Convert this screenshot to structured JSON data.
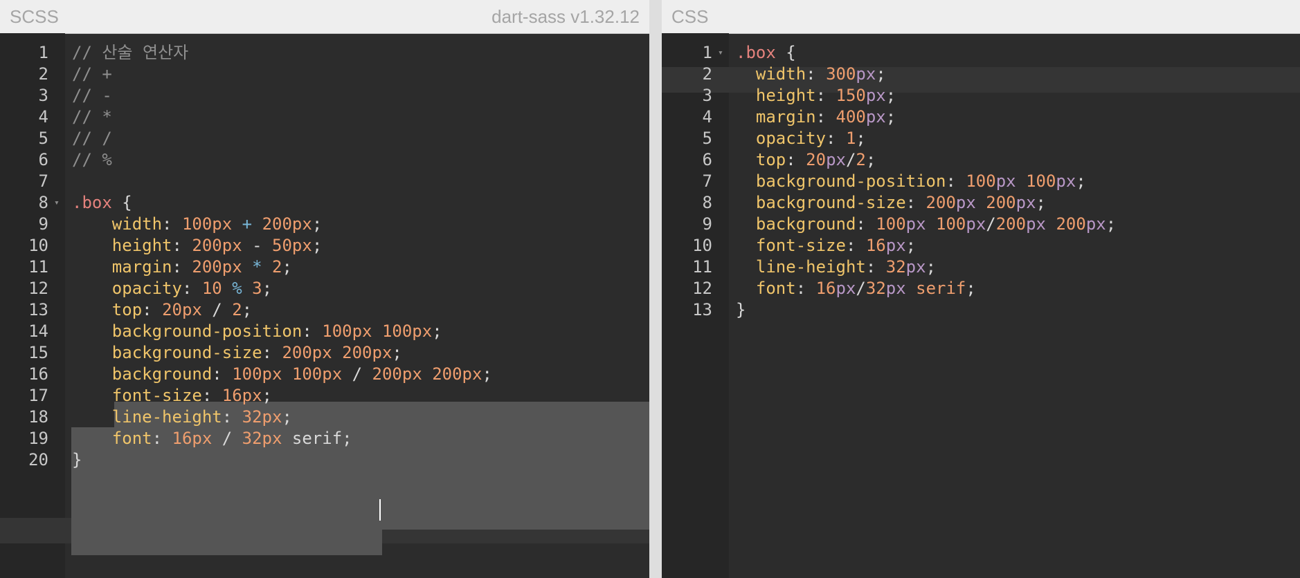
{
  "scss_pane": {
    "title": "SCSS",
    "version": "dart-sass v1.32.12",
    "lines": [
      {
        "n": "1",
        "tokens": [
          {
            "t": "// 산술 연산자",
            "c": "cm"
          }
        ]
      },
      {
        "n": "2",
        "tokens": [
          {
            "t": "// +",
            "c": "cm"
          }
        ]
      },
      {
        "n": "3",
        "tokens": [
          {
            "t": "// -",
            "c": "cm"
          }
        ]
      },
      {
        "n": "4",
        "tokens": [
          {
            "t": "// *",
            "c": "cm"
          }
        ]
      },
      {
        "n": "5",
        "tokens": [
          {
            "t": "// /",
            "c": "cm"
          }
        ]
      },
      {
        "n": "6",
        "tokens": [
          {
            "t": "// %",
            "c": "cm"
          }
        ]
      },
      {
        "n": "7",
        "tokens": []
      },
      {
        "n": "8",
        "fold": "▾",
        "tokens": [
          {
            "t": ".box",
            "c": "sel"
          },
          {
            "t": " {",
            "c": "pl"
          }
        ]
      },
      {
        "n": "9",
        "tokens": [
          {
            "t": "    width",
            "c": "prop"
          },
          {
            "t": ": ",
            "c": "pl"
          },
          {
            "t": "100px",
            "c": "num"
          },
          {
            "t": " + ",
            "c": "op"
          },
          {
            "t": "200px",
            "c": "num"
          },
          {
            "t": ";",
            "c": "pl"
          }
        ]
      },
      {
        "n": "10",
        "tokens": [
          {
            "t": "    height",
            "c": "prop"
          },
          {
            "t": ": ",
            "c": "pl"
          },
          {
            "t": "200px",
            "c": "num"
          },
          {
            "t": " - ",
            "c": "pl"
          },
          {
            "t": "50px",
            "c": "num"
          },
          {
            "t": ";",
            "c": "pl"
          }
        ]
      },
      {
        "n": "11",
        "tokens": [
          {
            "t": "    margin",
            "c": "prop"
          },
          {
            "t": ": ",
            "c": "pl"
          },
          {
            "t": "200px",
            "c": "num"
          },
          {
            "t": " * ",
            "c": "op"
          },
          {
            "t": "2",
            "c": "num"
          },
          {
            "t": ";",
            "c": "pl"
          }
        ]
      },
      {
        "n": "12",
        "tokens": [
          {
            "t": "    opacity",
            "c": "prop"
          },
          {
            "t": ": ",
            "c": "pl"
          },
          {
            "t": "10",
            "c": "num"
          },
          {
            "t": " % ",
            "c": "op"
          },
          {
            "t": "3",
            "c": "num"
          },
          {
            "t": ";",
            "c": "pl"
          }
        ]
      },
      {
        "n": "13",
        "tokens": [
          {
            "t": "    top",
            "c": "prop"
          },
          {
            "t": ": ",
            "c": "pl"
          },
          {
            "t": "20px",
            "c": "num"
          },
          {
            "t": " / ",
            "c": "pl"
          },
          {
            "t": "2",
            "c": "num"
          },
          {
            "t": ";",
            "c": "pl"
          }
        ]
      },
      {
        "n": "14",
        "tokens": [
          {
            "t": "    background-position",
            "c": "prop"
          },
          {
            "t": ": ",
            "c": "pl"
          },
          {
            "t": "100px 100px",
            "c": "num"
          },
          {
            "t": ";",
            "c": "pl"
          }
        ]
      },
      {
        "n": "15",
        "tokens": [
          {
            "t": "    background-size",
            "c": "prop"
          },
          {
            "t": ": ",
            "c": "pl"
          },
          {
            "t": "200px 200px",
            "c": "num"
          },
          {
            "t": ";",
            "c": "pl"
          }
        ]
      },
      {
        "n": "16",
        "tokens": [
          {
            "t": "    background",
            "c": "prop"
          },
          {
            "t": ": ",
            "c": "pl"
          },
          {
            "t": "100px 100px",
            "c": "num"
          },
          {
            "t": " / ",
            "c": "pl"
          },
          {
            "t": "200px 200px",
            "c": "num"
          },
          {
            "t": ";",
            "c": "pl"
          }
        ]
      },
      {
        "n": "17",
        "tokens": [
          {
            "t": "    font-size",
            "c": "prop"
          },
          {
            "t": ": ",
            "c": "pl"
          },
          {
            "t": "16px",
            "c": "num"
          },
          {
            "t": ";",
            "c": "pl"
          }
        ]
      },
      {
        "n": "18",
        "tokens": [
          {
            "t": "    line-height",
            "c": "prop"
          },
          {
            "t": ": ",
            "c": "pl"
          },
          {
            "t": "32px",
            "c": "num"
          },
          {
            "t": ";",
            "c": "pl"
          }
        ]
      },
      {
        "n": "19",
        "tokens": [
          {
            "t": "    font",
            "c": "prop"
          },
          {
            "t": ": ",
            "c": "pl"
          },
          {
            "t": "16px",
            "c": "num"
          },
          {
            "t": " / ",
            "c": "pl"
          },
          {
            "t": "32px",
            "c": "num"
          },
          {
            "t": " serif;",
            "c": "pl"
          }
        ]
      },
      {
        "n": "20",
        "tokens": [
          {
            "t": "}",
            "c": "pl"
          }
        ]
      }
    ]
  },
  "css_pane": {
    "title": "CSS",
    "lines": [
      {
        "n": "1",
        "fold": "▾",
        "tokens": [
          {
            "t": ".box",
            "c": "sel"
          },
          {
            "t": " {",
            "c": "pl"
          }
        ]
      },
      {
        "n": "2",
        "tokens": [
          {
            "t": "  width",
            "c": "prop"
          },
          {
            "t": ": ",
            "c": "pl"
          },
          {
            "t": "300",
            "c": "num"
          },
          {
            "t": "px",
            "c": "unit"
          },
          {
            "t": ";",
            "c": "pl"
          }
        ]
      },
      {
        "n": "3",
        "tokens": [
          {
            "t": "  height",
            "c": "prop"
          },
          {
            "t": ": ",
            "c": "pl"
          },
          {
            "t": "150",
            "c": "num"
          },
          {
            "t": "px",
            "c": "unit"
          },
          {
            "t": ";",
            "c": "pl"
          }
        ]
      },
      {
        "n": "4",
        "tokens": [
          {
            "t": "  margin",
            "c": "prop"
          },
          {
            "t": ": ",
            "c": "pl"
          },
          {
            "t": "400",
            "c": "num"
          },
          {
            "t": "px",
            "c": "unit"
          },
          {
            "t": ";",
            "c": "pl"
          }
        ]
      },
      {
        "n": "5",
        "tokens": [
          {
            "t": "  opacity",
            "c": "prop"
          },
          {
            "t": ": ",
            "c": "pl"
          },
          {
            "t": "1",
            "c": "num"
          },
          {
            "t": ";",
            "c": "pl"
          }
        ]
      },
      {
        "n": "6",
        "tokens": [
          {
            "t": "  top",
            "c": "prop"
          },
          {
            "t": ": ",
            "c": "pl"
          },
          {
            "t": "20",
            "c": "num"
          },
          {
            "t": "px",
            "c": "unit"
          },
          {
            "t": "/",
            "c": "pl"
          },
          {
            "t": "2",
            "c": "num"
          },
          {
            "t": ";",
            "c": "pl"
          }
        ]
      },
      {
        "n": "7",
        "tokens": [
          {
            "t": "  background-position",
            "c": "prop"
          },
          {
            "t": ": ",
            "c": "pl"
          },
          {
            "t": "100",
            "c": "num"
          },
          {
            "t": "px",
            "c": "unit"
          },
          {
            "t": " ",
            "c": "pl"
          },
          {
            "t": "100",
            "c": "num"
          },
          {
            "t": "px",
            "c": "unit"
          },
          {
            "t": ";",
            "c": "pl"
          }
        ]
      },
      {
        "n": "8",
        "tokens": [
          {
            "t": "  background-size",
            "c": "prop"
          },
          {
            "t": ": ",
            "c": "pl"
          },
          {
            "t": "200",
            "c": "num"
          },
          {
            "t": "px",
            "c": "unit"
          },
          {
            "t": " ",
            "c": "pl"
          },
          {
            "t": "200",
            "c": "num"
          },
          {
            "t": "px",
            "c": "unit"
          },
          {
            "t": ";",
            "c": "pl"
          }
        ]
      },
      {
        "n": "9",
        "tokens": [
          {
            "t": "  background",
            "c": "prop"
          },
          {
            "t": ": ",
            "c": "pl"
          },
          {
            "t": "100",
            "c": "num"
          },
          {
            "t": "px",
            "c": "unit"
          },
          {
            "t": " ",
            "c": "pl"
          },
          {
            "t": "100",
            "c": "num"
          },
          {
            "t": "px",
            "c": "unit"
          },
          {
            "t": "/",
            "c": "pl"
          },
          {
            "t": "200",
            "c": "num"
          },
          {
            "t": "px",
            "c": "unit"
          },
          {
            "t": " ",
            "c": "pl"
          },
          {
            "t": "200",
            "c": "num"
          },
          {
            "t": "px",
            "c": "unit"
          },
          {
            "t": ";",
            "c": "pl"
          }
        ]
      },
      {
        "n": "10",
        "tokens": [
          {
            "t": "  font-size",
            "c": "prop"
          },
          {
            "t": ": ",
            "c": "pl"
          },
          {
            "t": "16",
            "c": "num"
          },
          {
            "t": "px",
            "c": "unit"
          },
          {
            "t": ";",
            "c": "pl"
          }
        ]
      },
      {
        "n": "11",
        "tokens": [
          {
            "t": "  line-height",
            "c": "prop"
          },
          {
            "t": ": ",
            "c": "pl"
          },
          {
            "t": "32",
            "c": "num"
          },
          {
            "t": "px",
            "c": "unit"
          },
          {
            "t": ";",
            "c": "pl"
          }
        ]
      },
      {
        "n": "12",
        "tokens": [
          {
            "t": "  font",
            "c": "prop"
          },
          {
            "t": ": ",
            "c": "pl"
          },
          {
            "t": "16",
            "c": "num"
          },
          {
            "t": "px",
            "c": "unit"
          },
          {
            "t": "/",
            "c": "pl"
          },
          {
            "t": "32",
            "c": "num"
          },
          {
            "t": "px",
            "c": "unit"
          },
          {
            "t": " serif",
            "c": "num"
          },
          {
            "t": ";",
            "c": "pl"
          }
        ]
      },
      {
        "n": "13",
        "tokens": [
          {
            "t": "}",
            "c": "pl"
          }
        ]
      }
    ]
  },
  "colors": {
    "editor_bg": "#2c2c2c",
    "gutter_bg": "#262626",
    "selection_bg": "#555555",
    "comment": "#8f8f8f",
    "selector": "#e4827d",
    "property": "#f0c56a",
    "number": "#ef9e6e",
    "unit": "#b998c7",
    "operator": "#78b6d7"
  }
}
